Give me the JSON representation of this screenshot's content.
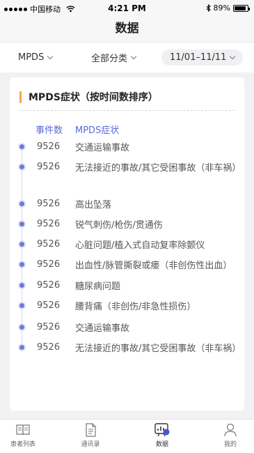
{
  "status": {
    "carrier": "中国移动",
    "time": "4:21 PM",
    "battery_pct": "89%",
    "battery_level": 0.89
  },
  "header": {
    "title": "数据"
  },
  "filters": {
    "source": "MPDS",
    "category": "全部分类",
    "date_range": "11/01–11/11"
  },
  "card": {
    "title": "MPDS症状（按时间数排序）",
    "accent_color": "#f0a94a",
    "columns": [
      "事件数",
      "MPDS症状"
    ],
    "rows": [
      {
        "count": "9526",
        "symptom": "交通运输事故"
      },
      {
        "count": "9526",
        "symptom": "无法接近的事故/其它受困事故（非车祸）"
      },
      {
        "count": "9526",
        "symptom": "高出坠落"
      },
      {
        "count": "9526",
        "symptom": "锐气刺伤/枪伤/贯通伤"
      },
      {
        "count": "9526",
        "symptom": "心脏问题/植入式自动复率除颤仪"
      },
      {
        "count": "9526",
        "symptom": "出血性/脉管撕裂或瘘（非创伤性出血）"
      },
      {
        "count": "9526",
        "symptom": "糖尿病问题"
      },
      {
        "count": "9526",
        "symptom": "腰背痛（非创伤/非急性损伤）"
      },
      {
        "count": "9526",
        "symptom": "交通运输事故"
      },
      {
        "count": "9526",
        "symptom": "无法接近的事故/其它受困事故（非车祸）"
      }
    ]
  },
  "tabs": [
    {
      "label": "患者列表",
      "icon": "book-icon"
    },
    {
      "label": "通讯录",
      "icon": "document-icon"
    },
    {
      "label": "数据",
      "icon": "chart-board-icon",
      "active": true
    },
    {
      "label": "我的",
      "icon": "person-icon"
    }
  ],
  "colors": {
    "accent": "#5a6bd6",
    "timeline_dot": "#6f7bd4"
  }
}
